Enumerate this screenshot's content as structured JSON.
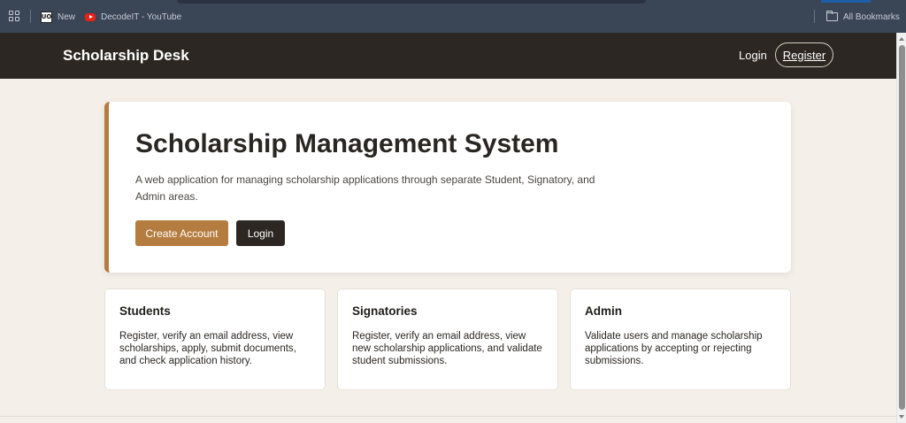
{
  "browser": {
    "bookmarks": [
      {
        "label": "New",
        "icon": "uo-favicon"
      },
      {
        "label": "DecodeIT - YouTube",
        "icon": "youtube-icon"
      }
    ],
    "all_bookmarks_label": "All Bookmarks"
  },
  "header": {
    "brand": "Scholarship Desk",
    "nav": {
      "login_label": "Login",
      "register_label": "Register"
    }
  },
  "hero": {
    "title": "Scholarship Management System",
    "description": "A web application for managing scholarship applications through separate Student, Signatory, and Admin areas.",
    "create_account_label": "Create Account",
    "login_label": "Login"
  },
  "features": [
    {
      "title": "Students",
      "text": "Register, verify an email address, view scholarships, apply, submit documents, and check application history."
    },
    {
      "title": "Signatories",
      "text": "Register, verify an email address, view new scholarship applications, and validate student submissions."
    },
    {
      "title": "Admin",
      "text": "Validate users and manage scholarship applications by accepting or rejecting submissions."
    }
  ],
  "colors": {
    "header_bg": "#2c2723",
    "accent": "#b57c3f",
    "page_bg": "#f4efe8",
    "browser_bar": "#3a4556"
  }
}
